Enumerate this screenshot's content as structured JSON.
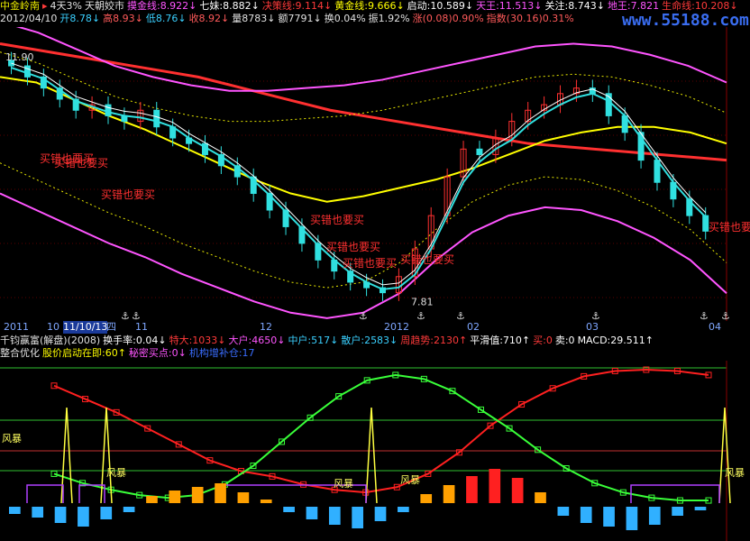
{
  "header1": [
    {
      "text": "中金岭南",
      "color": "#e8e800"
    },
    {
      "text": "▸",
      "color": "#ff3a3a"
    },
    {
      "text": "4天3%",
      "color": "#e0e0e0"
    },
    {
      "text": "天朝姣市",
      "color": "#e0e0e0"
    },
    {
      "text": "摸金线:8.922↓",
      "color": "#ff55ff"
    },
    {
      "text": "七妹:8.882↓",
      "color": "#ffffff"
    },
    {
      "text": "决策线:9.114↓",
      "color": "#ff3a3a"
    },
    {
      "text": "黄金线:9.666↓",
      "color": "#ffff00"
    },
    {
      "text": "启动:10.589↓",
      "color": "#ffffff"
    },
    {
      "text": "天王:11.513↓",
      "color": "#ff55ff"
    },
    {
      "text": "关注:8.743↓",
      "color": "#ffffff"
    },
    {
      "text": "地王:7.821",
      "color": "#ff55ff"
    },
    {
      "text": "生命线:10.208↓",
      "color": "#ff3a3a"
    }
  ],
  "header2": [
    {
      "text": "2012/04/10",
      "color": "#e0e0e0"
    },
    {
      "text": "开8.78↓",
      "color": "#3ad0ff"
    },
    {
      "text": "高8.93↓",
      "color": "#ff5a5a"
    },
    {
      "text": "低8.76↓",
      "color": "#3ad0ff"
    },
    {
      "text": "收8.92↓",
      "color": "#ff5a5a"
    },
    {
      "text": "量8783↓",
      "color": "#e0e0e0"
    },
    {
      "text": "额7791↓",
      "color": "#e0e0e0"
    },
    {
      "text": "换0.04%",
      "color": "#e0e0e0"
    },
    {
      "text": "振1.92%",
      "color": "#e0e0e0"
    },
    {
      "text": "涨(0.08)0.90%",
      "color": "#ff5a5a"
    },
    {
      "text": "指数(30.16)0.31%",
      "color": "#ff5a5a"
    }
  ],
  "watermark": "www.55188.com",
  "date_axis": [
    "2011",
    "10",
    "11/10/13",
    "四",
    "11",
    "12",
    "2012",
    "02",
    "03",
    "04"
  ],
  "mid1": [
    {
      "text": "千钧赢富(解盘)(2008)",
      "color": "#e0e0e0"
    },
    {
      "text": "换手率:0.04↓",
      "color": "#ffffff"
    },
    {
      "text": "特大:1033↓",
      "color": "#ff3a3a"
    },
    {
      "text": "大户:4650↓",
      "color": "#ff55ff"
    },
    {
      "text": "中户:517↓",
      "color": "#3ad0ff"
    },
    {
      "text": "散户:2583↓",
      "color": "#3ad0ff"
    },
    {
      "text": "周趋势:2130↑",
      "color": "#ff3a3a"
    },
    {
      "text": "平滑值:710↑",
      "color": "#ffffff"
    },
    {
      "text": "买:0",
      "color": "#ff3a3a"
    },
    {
      "text": "卖:0",
      "color": "#ffffff"
    },
    {
      "text": "MACD:29.511↑",
      "color": "#ffffff"
    }
  ],
  "mid2": [
    {
      "text": "整合优化",
      "color": "#e0e0e0"
    },
    {
      "text": "股价启动在即:60↑",
      "color": "#ffff00"
    },
    {
      "text": "秘密买点:0↓",
      "color": "#ff55ff"
    },
    {
      "text": "机构增补仓:17",
      "color": "#3a6dff"
    }
  ],
  "price_labels": {
    "high": "11.90",
    "low": "7.81"
  },
  "annotations": {
    "buy": [
      "买错也要买",
      "买错也要买",
      "买错也要买",
      "买错也要买",
      "买错也要买",
      "买错也要买",
      "买错也要买",
      "买错也要买"
    ],
    "storm": [
      "风暴",
      "风暴",
      "风暴",
      "风暴",
      "风暴"
    ]
  },
  "chart_data": [
    {
      "type": "line",
      "title": "",
      "y_range": [
        7.3,
        12.6
      ],
      "n_bars": 200,
      "series": [
        {
          "name": "生命线",
          "color": "#ff3030",
          "values": [
            12.3,
            12.2,
            12.1,
            12.0,
            11.9,
            11.8,
            11.7,
            11.55,
            11.4,
            11.25,
            11.1,
            11.0,
            10.9,
            10.8,
            10.7,
            10.6,
            10.5,
            10.45,
            10.4,
            10.35,
            10.3,
            10.25,
            10.2
          ]
        },
        {
          "name": "黄金线",
          "color": "#ffff00",
          "values": [
            11.7,
            11.6,
            11.3,
            11.0,
            10.75,
            10.45,
            10.15,
            9.85,
            9.6,
            9.45,
            9.55,
            9.7,
            9.85,
            10.05,
            10.3,
            10.55,
            10.7,
            10.8,
            10.8,
            10.7,
            10.5
          ]
        },
        {
          "name": "天王",
          "color": "#ff55ff",
          "values": [
            12.7,
            12.5,
            12.2,
            11.9,
            11.7,
            11.55,
            11.45,
            11.45,
            11.5,
            11.55,
            11.65,
            11.8,
            11.95,
            12.1,
            12.25,
            12.3,
            12.25,
            12.1,
            11.9,
            11.6
          ]
        },
        {
          "name": "地王",
          "color": "#ff55ff",
          "values": [
            9.6,
            9.3,
            9.0,
            8.7,
            8.45,
            8.15,
            7.9,
            7.65,
            7.45,
            7.35,
            7.45,
            7.8,
            8.4,
            8.9,
            9.2,
            9.35,
            9.3,
            9.1,
            8.8,
            8.4,
            7.8
          ]
        }
      ],
      "candles_close": [
        11.9,
        11.7,
        11.5,
        11.3,
        11.1,
        11.2,
        11.0,
        10.9,
        11.1,
        10.8,
        10.6,
        10.5,
        10.3,
        10.1,
        9.9,
        9.6,
        9.3,
        9.0,
        8.7,
        8.4,
        8.2,
        8.0,
        7.9,
        7.81,
        8.1,
        8.6,
        9.2,
        9.9,
        10.4,
        10.3,
        10.6,
        10.9,
        11.1,
        11.2,
        11.4,
        11.5,
        11.4,
        11.0,
        10.7,
        10.2,
        9.8,
        9.5,
        9.2,
        8.92
      ]
    },
    {
      "type": "line",
      "title": "",
      "y_range": [
        0,
        100
      ],
      "series": [
        {
          "name": "",
          "color": "#ff2020",
          "values": [
            88,
            78,
            68,
            56,
            44,
            32,
            24,
            20,
            14,
            10,
            8,
            12,
            22,
            38,
            58,
            74,
            86,
            95,
            99,
            100,
            99,
            96
          ]
        },
        {
          "name": "",
          "color": "#39ff39",
          "values": [
            22,
            15,
            10,
            6,
            4,
            6,
            14,
            28,
            46,
            64,
            80,
            92,
            96,
            93,
            84,
            70,
            56,
            40,
            26,
            15,
            8,
            4,
            2,
            2
          ]
        }
      ],
      "histogram": [
        -8,
        -12,
        -18,
        -22,
        -14,
        -6,
        8,
        14,
        18,
        22,
        12,
        4,
        -6,
        -14,
        -20,
        -24,
        -16,
        -6,
        10,
        20,
        30,
        38,
        28,
        12,
        -10,
        -18,
        -22,
        -26,
        -20,
        -10,
        -4
      ]
    }
  ]
}
